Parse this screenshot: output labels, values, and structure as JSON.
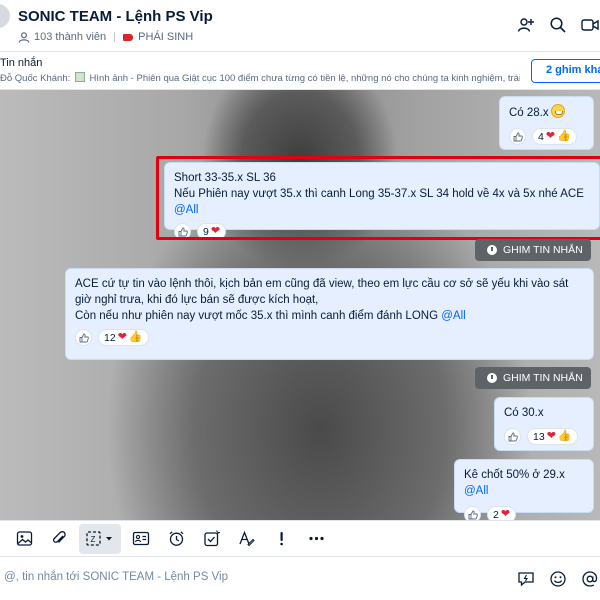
{
  "header": {
    "title": "SONIC TEAM - Lệnh PS Vip",
    "members": "103 thành viên",
    "tag": "PHÁI SINH"
  },
  "pinned": {
    "title": "Tin nhắn",
    "sender": "Đỗ Quốc Khánh:",
    "text_prefix": "Hình ảnh - Phiên qua Giật cục 100 điểm chưa từng có tiền lệ, những nó cho chúng ta kinh nghiệm, trái ...",
    "count_button": "2 ghim khác"
  },
  "messages": [
    {
      "text": "Có 28.x",
      "count": "4"
    },
    {
      "text": "Short 33-35.x SL 36\nNếu Phiên nay vượt 35.x thì canh Long 35-37.x SL 34 hold về 4x và 5x nhé ACE ",
      "mention": "@All",
      "count": "9"
    },
    {
      "text": "ACE cứ tự tin vào lệnh thôi, kịch bản em cũng đã view, theo em lực cầu cơ sở sẽ yếu khi vào sát giờ nghỉ trưa, khi đó lực bán sẽ được kích hoạt,\nCòn nếu như phiên nay vượt mốc 35.x thì mình canh điểm đánh LONG ",
      "mention": "@All",
      "count": "12"
    },
    {
      "text": "Có 30.x",
      "count": "13"
    },
    {
      "text": "Kê chốt 50% ở 29.x ",
      "mention": "@All",
      "count": "2"
    }
  ],
  "pin_label": "GHIM TIN NHẮN",
  "input": {
    "placeholder": "@, tin nhắn tới SONIC TEAM - Lệnh PS Vip"
  },
  "icons": {
    "header": [
      "add-member-icon",
      "search-icon",
      "video-call-icon"
    ],
    "toolbar": [
      "image-icon",
      "attachment-icon",
      "screenshot-icon",
      "contact-card-icon",
      "reminder-clock-icon",
      "task-icon",
      "text-format-icon",
      "urgent-icon",
      "more-icon"
    ],
    "input": [
      "quick-message-icon",
      "emoji-icon",
      "mention-icon"
    ]
  },
  "colors": {
    "accent": "#0068ff",
    "highlight": "#e10010",
    "bubble": "#e5efff",
    "heart": "#e0243a"
  }
}
